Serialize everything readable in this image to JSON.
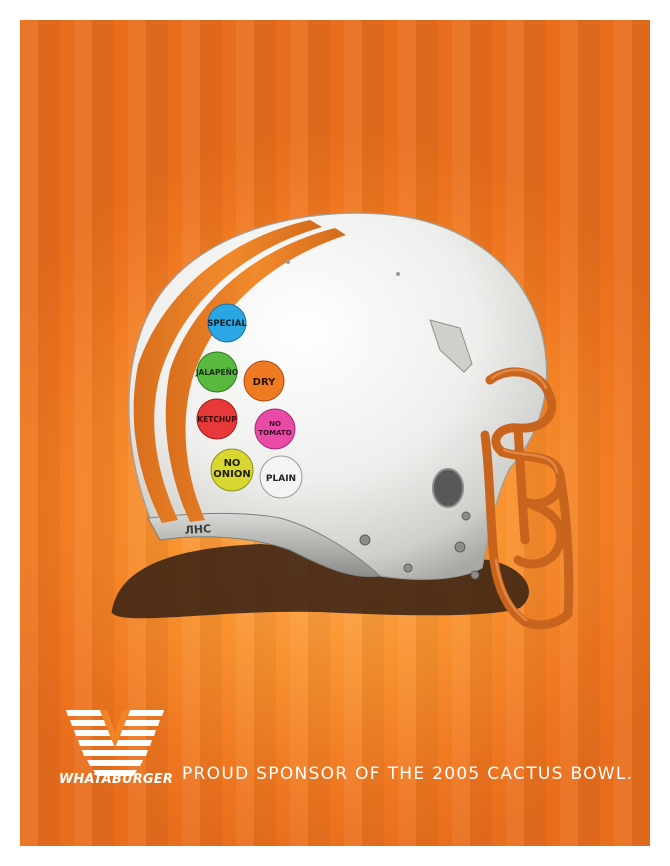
{
  "ad": {
    "tagline": "PROUD SPONSOR OF THE 2005 CACTUS BOWL.",
    "brand_name": "WHATABURGER",
    "colors": {
      "background": "#f18426",
      "stripe": "#e9711c",
      "helmet": "#f2f2f0",
      "facemask": "#c9641f",
      "text": "#ffffff"
    }
  },
  "helmet": {
    "stickers": [
      {
        "line1": "SPECIAL",
        "line2": "",
        "color": "#2aa6e2"
      },
      {
        "line1": "JALAPEÑO",
        "line2": "",
        "color": "#58b93e"
      },
      {
        "line1": "DRY",
        "line2": "",
        "color": "#f07a22"
      },
      {
        "line1": "KETCHUP",
        "line2": "",
        "color": "#e8393a"
      },
      {
        "line1": "NO",
        "line2": "TOMATO",
        "color": "#e94aa6"
      },
      {
        "line1": "NO",
        "line2": "ONION",
        "color": "#d8d631"
      },
      {
        "line1": "PLAIN",
        "line2": "",
        "color": "#f4f4f2"
      }
    ],
    "visor_text": "ЛНС"
  }
}
